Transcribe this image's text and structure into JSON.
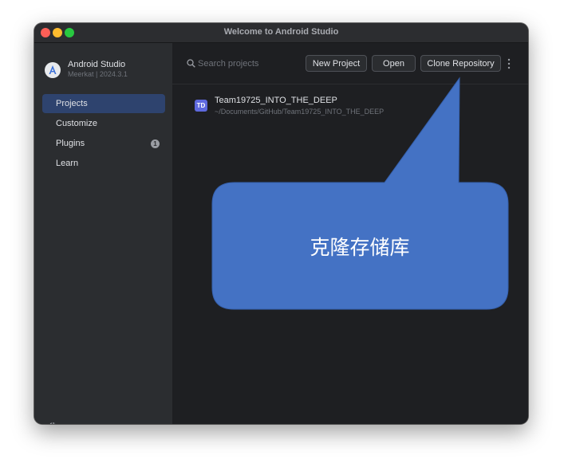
{
  "window": {
    "title": "Welcome to Android Studio"
  },
  "sidebar": {
    "app_name": "Android Studio",
    "app_version": "Meerkat | 2024.3.1",
    "items": [
      {
        "label": "Projects",
        "selected": true
      },
      {
        "label": "Customize",
        "selected": false
      },
      {
        "label": "Plugins",
        "selected": false,
        "badge": "1"
      },
      {
        "label": "Learn",
        "selected": false
      }
    ]
  },
  "main": {
    "search": {
      "placeholder": "Search projects",
      "value": ""
    },
    "buttons": {
      "new_project": "New Project",
      "open": "Open",
      "clone_repository": "Clone Repository"
    },
    "projects": [
      {
        "initials": "TD",
        "name": "Team19725_INTO_THE_DEEP",
        "path": "~/Documents/GitHub/Team19725_INTO_THE_DEEP"
      }
    ]
  },
  "callout": {
    "text": "克隆存储库",
    "color": "#4472c4"
  },
  "icons": {
    "logo": "android-studio-logo-icon",
    "search": "search-icon",
    "more": "more-vertical-icon",
    "settings": "gear-icon"
  }
}
